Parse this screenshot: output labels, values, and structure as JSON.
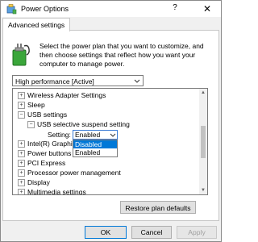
{
  "window": {
    "title": "Power Options",
    "help": "?",
    "close": "✕",
    "icon": "power-options-icon"
  },
  "tabs": [
    {
      "label": "Advanced settings"
    }
  ],
  "panel": {
    "description": "Select the power plan that you want to customize, and then choose settings that reflect how you want your computer to manage power.",
    "plan_select": {
      "value": "High performance [Active]"
    },
    "tree": [
      {
        "label": "Wireless Adapter Settings",
        "expander": "+"
      },
      {
        "label": "Sleep",
        "expander": "+"
      },
      {
        "label": "USB settings",
        "expander": "−"
      },
      {
        "label": "USB selective suspend setting",
        "expander": "−"
      },
      {
        "label": "Intel(R) Graphics Settings",
        "expander": "+"
      },
      {
        "label": "Power buttons and lid",
        "expander": "+"
      },
      {
        "label": "PCI Express",
        "expander": "+"
      },
      {
        "label": "Processor power management",
        "expander": "+"
      },
      {
        "label": "Display",
        "expander": "+"
      },
      {
        "label": "Multimedia settings",
        "expander": "+"
      }
    ],
    "setting": {
      "label": "Setting:",
      "value": "Enabled",
      "options": [
        "Disabled",
        "Enabled"
      ],
      "highlighted": "Disabled"
    },
    "restore_label": "Restore plan defaults"
  },
  "buttons": {
    "ok": "OK",
    "cancel": "Cancel",
    "apply": "Apply"
  },
  "colors": {
    "accent": "#0078d7",
    "battery_green": "#3aa63a"
  }
}
